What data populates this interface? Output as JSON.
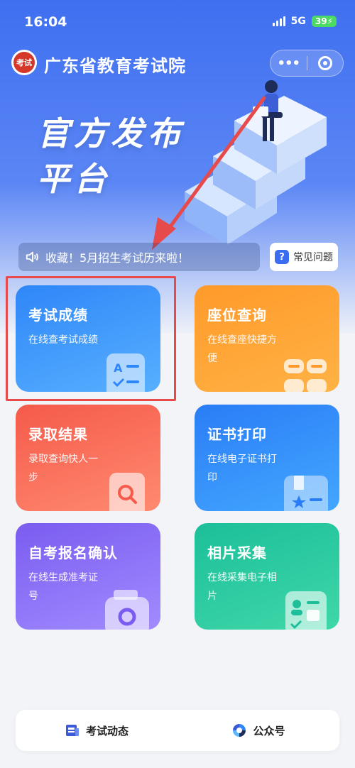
{
  "status_bar": {
    "time": "16:04",
    "network": "5G",
    "battery": "39"
  },
  "header": {
    "logo_text": "考试",
    "title": "广东省教育考试院",
    "more_icon": "more-dots-icon",
    "close_icon": "target-close-icon"
  },
  "banner": {
    "line1": "官方发布",
    "line2": "平台"
  },
  "notice": {
    "icon": "speaker-icon",
    "text": "收藏！5月招生考试历来啦！"
  },
  "faq": {
    "icon_text": "?",
    "label": "常见问题"
  },
  "cards": [
    {
      "title": "考试成绩",
      "subtitle": "在线查考试成绩",
      "icon": "score-sheet-icon",
      "color": "#2f86f8"
    },
    {
      "title": "座位查询",
      "subtitle": "在线查座快捷方便",
      "icon": "seats-icon",
      "color": "#ff9a2a"
    },
    {
      "title": "录取结果",
      "subtitle": "录取查询快人一步",
      "icon": "search-doc-icon",
      "color": "#f55a4a"
    },
    {
      "title": "证书打印",
      "subtitle": "在线电子证书打印",
      "icon": "certificate-icon",
      "color": "#2a7df6"
    },
    {
      "title": "自考报名确认",
      "subtitle": "在线生成准考证号",
      "icon": "camera-doc-icon",
      "color": "#7a5cf0"
    },
    {
      "title": "相片采集",
      "subtitle": "在线采集电子相片",
      "icon": "photo-id-icon",
      "color": "#1cbf9a"
    }
  ],
  "bottom_nav": [
    {
      "label": "考试动态",
      "icon": "news-icon"
    },
    {
      "label": "公众号",
      "icon": "official-account-icon"
    }
  ],
  "annotation_color": "#e64a4a"
}
